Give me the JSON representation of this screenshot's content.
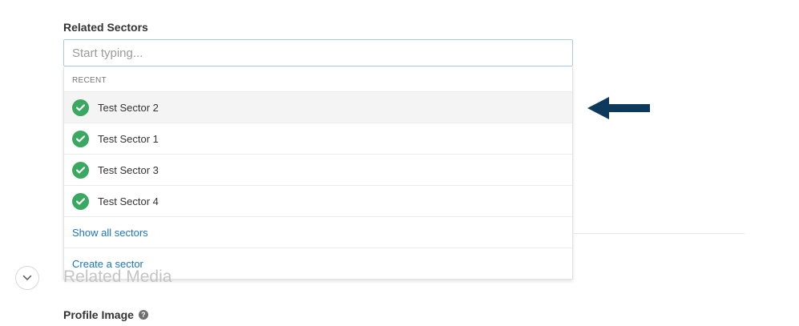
{
  "related_sectors": {
    "label": "Related Sectors",
    "search": {
      "value": "",
      "placeholder": "Start typing..."
    },
    "dropdown": {
      "section_header": "RECENT",
      "options": [
        {
          "label": "Test Sector 2",
          "icon": "check-circle-icon"
        },
        {
          "label": "Test Sector 1",
          "icon": "check-circle-icon"
        },
        {
          "label": "Test Sector 3",
          "icon": "check-circle-icon"
        },
        {
          "label": "Test Sector 4",
          "icon": "check-circle-icon"
        }
      ],
      "show_all_label": "Show all sectors",
      "create_label": "Create a sector"
    }
  },
  "related_media": {
    "title": "Related Media",
    "toggle_icon": "chevron-down-icon"
  },
  "profile_image": {
    "label": "Profile Image",
    "help_icon": "question-circle-icon",
    "help_glyph": "?"
  },
  "colors": {
    "check_green": "#3aa860",
    "link_blue": "#1b75bc",
    "arrow_navy": "#0d3a5c",
    "input_border": "#a9c7e6",
    "highlight_bg": "#f4f4f4"
  }
}
